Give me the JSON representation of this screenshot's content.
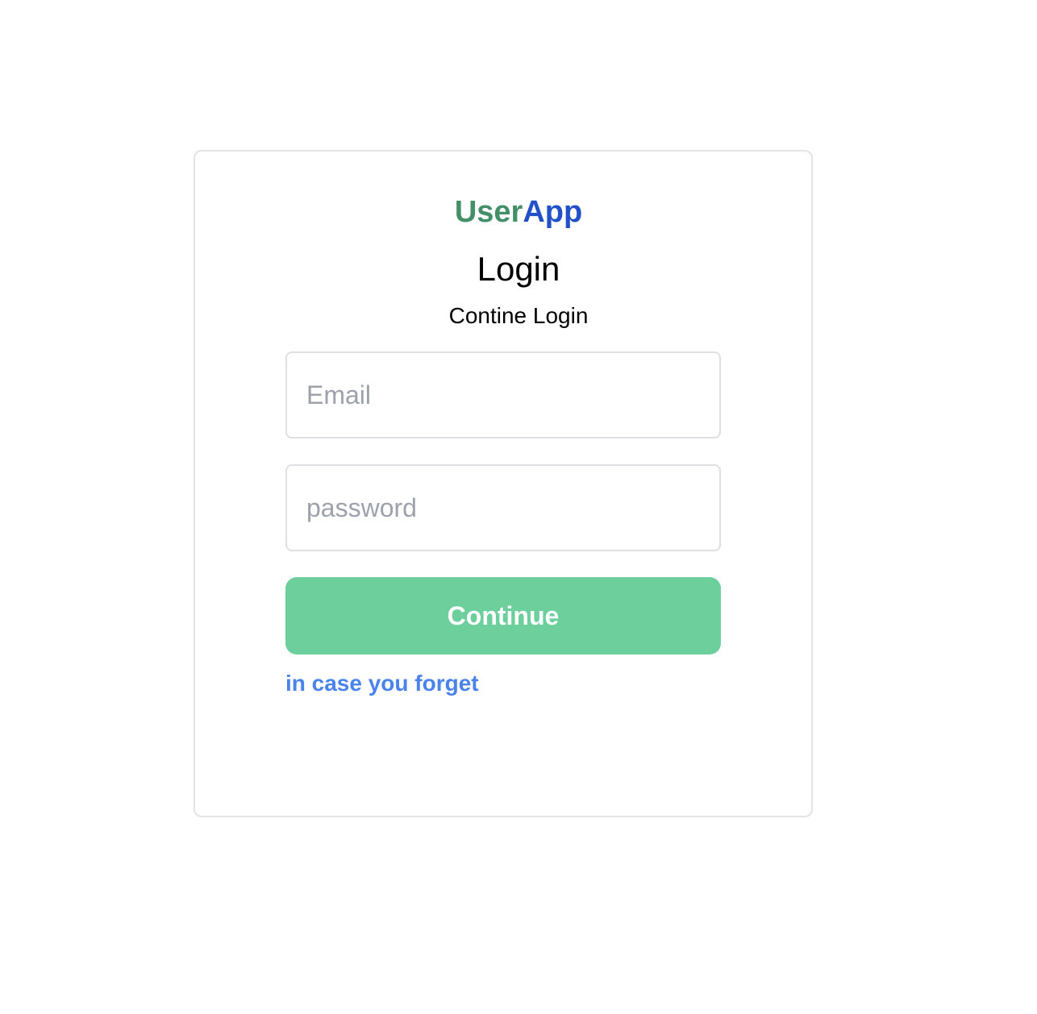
{
  "brand": {
    "part1": "User",
    "part2": "App",
    "part1_color": "#428f68",
    "part2_color": "#2250c8"
  },
  "login": {
    "title": "Login",
    "subtitle": "Contine Login",
    "email_placeholder": "Email",
    "email_value": "",
    "password_placeholder": "password",
    "password_value": "",
    "continue_label": "Continue",
    "forgot_label": "in case you forget"
  },
  "colors": {
    "button_bg": "#6ccf9c",
    "link": "#4a83ec",
    "border": "#e2e3e5"
  }
}
